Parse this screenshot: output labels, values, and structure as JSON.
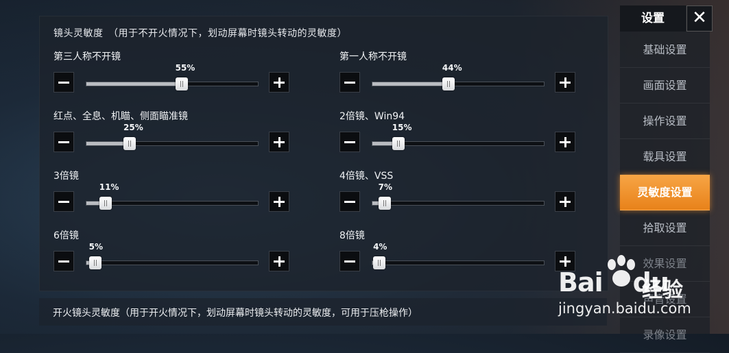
{
  "panel": {
    "title": "镜头灵敏度　（用于不开火情况下，划动屏幕时镜头转动的灵敏度）",
    "items": [
      {
        "label": "第三人称不开镜",
        "value": 55,
        "value_label": "55%"
      },
      {
        "label": "第一人称不开镜",
        "value": 44,
        "value_label": "44%"
      },
      {
        "label": "红点、全息、机瞄、侧面瞄准镜",
        "value": 25,
        "value_label": "25%"
      },
      {
        "label": "2倍镜、Win94",
        "value": 15,
        "value_label": "15%"
      },
      {
        "label": "3倍镜",
        "value": 11,
        "value_label": "11%"
      },
      {
        "label": "4倍镜、VSS",
        "value": 7,
        "value_label": "7%"
      },
      {
        "label": "6倍镜",
        "value": 5,
        "value_label": "5%"
      },
      {
        "label": "8倍镜",
        "value": 4,
        "value_label": "4%"
      }
    ]
  },
  "fire_section": {
    "title": "开火镜头灵敏度（用于开火情况下，划动屏幕时镜头转动的灵敏度，可用于压枪操作）"
  },
  "sidebar": {
    "title": "设置",
    "close_icon": "✕",
    "items": [
      {
        "label": "基础设置",
        "active": false
      },
      {
        "label": "画面设置",
        "active": false
      },
      {
        "label": "操作设置",
        "active": false
      },
      {
        "label": "载具设置",
        "active": false
      },
      {
        "label": "灵敏度设置",
        "active": true
      },
      {
        "label": "拾取设置",
        "active": false
      },
      {
        "label": "效果设置",
        "active": false
      },
      {
        "label": "声音设置",
        "active": false
      },
      {
        "label": "录像设置",
        "active": false
      }
    ]
  },
  "watermark": {
    "brand_left": "Bai",
    "brand_right": "du",
    "brand_cn": "经验",
    "url": "jingyan.baidu.com"
  },
  "colors": {
    "accent": "#f39a35",
    "panel_bg": "#1c222c"
  },
  "icons": {
    "minus": "minus-icon",
    "plus": "plus-icon",
    "close": "close-icon"
  }
}
